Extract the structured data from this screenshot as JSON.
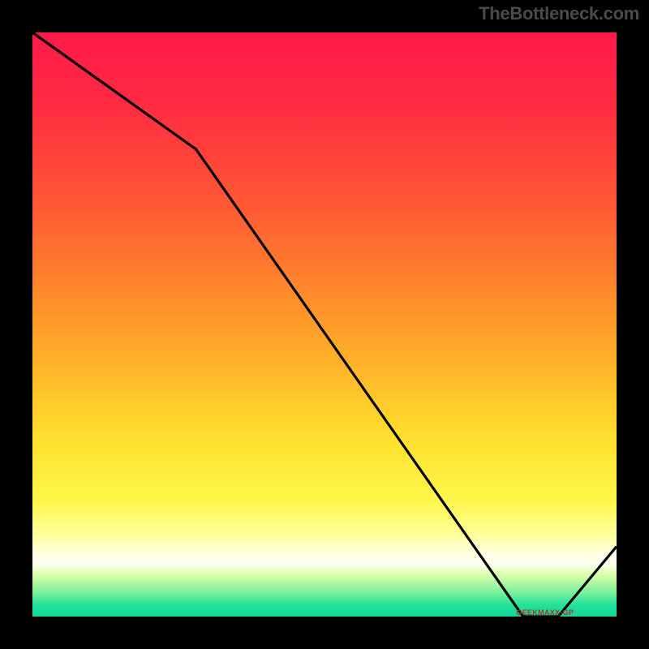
{
  "watermark": "TheBottleneck.com",
  "series_label": "GEEKMAXX-GP",
  "chart_data": {
    "type": "line",
    "title": "",
    "xlabel": "",
    "ylabel": "",
    "x": [
      0,
      0.28,
      0.84,
      0.9,
      1.0
    ],
    "values": [
      1.0,
      0.8,
      0.0,
      0.0,
      0.12
    ],
    "xlim": [
      0,
      1
    ],
    "ylim": [
      0,
      1
    ],
    "series": [
      {
        "name": "GEEKMAXX-GP",
        "values": [
          1.0,
          0.8,
          0.0,
          0.0,
          0.12
        ]
      }
    ],
    "background": "rainbow-vertical-gradient",
    "legend_position": "on-curve",
    "grid": false
  },
  "colors": {
    "line": "#000000",
    "label": "#b42f2a",
    "gradient_top": "#ff1a4a",
    "gradient_mid": "#ffe12e",
    "gradient_bottom": "#10d79a"
  }
}
